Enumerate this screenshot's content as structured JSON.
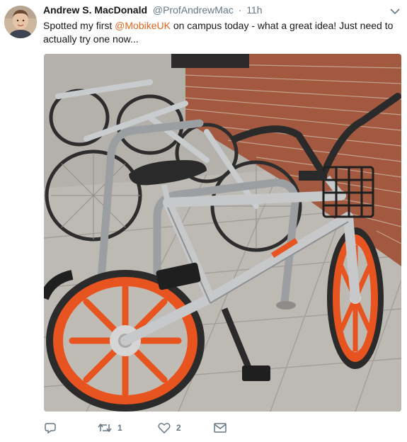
{
  "tweet": {
    "author_name": "Andrew S. MacDonald",
    "handle": "@ProfAndrewMac",
    "separator": "·",
    "time": "11h",
    "text_before": "Spotted my first ",
    "mention": "@MobikeUK",
    "text_after": " on campus today - what a great idea!  Just need to actually try one now...",
    "accent_color": "#e3651c"
  },
  "actions": {
    "reply_icon": "reply-icon",
    "retweet_icon": "retweet-icon",
    "retweet_count": "1",
    "like_icon": "heart-icon",
    "like_count": "2",
    "message_icon": "envelope-icon"
  },
  "colors": {
    "text": "#14171a",
    "muted": "#657786",
    "bike_orange": "#e8541f",
    "bike_silver": "#c5c7c9",
    "brick": "#9a4a35"
  }
}
